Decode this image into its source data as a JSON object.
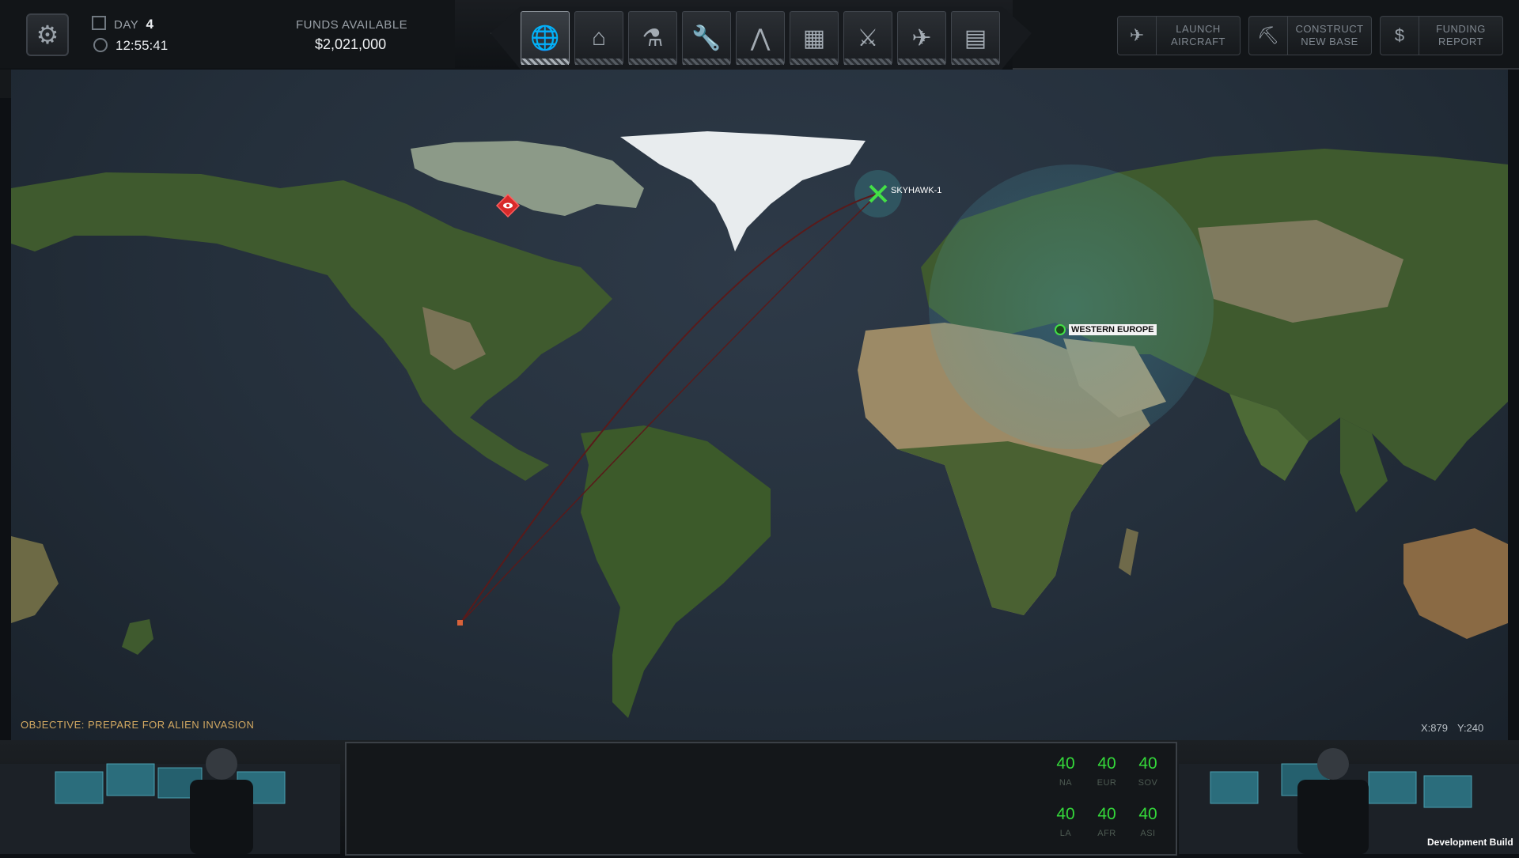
{
  "header": {
    "day_label": "DAY",
    "day_value": "4",
    "time": "12:55:41",
    "funds_label": "FUNDS AVAILABLE",
    "funds_value": "$2,021,000"
  },
  "nav": [
    {
      "name": "geoscape",
      "icon": "globe-icon",
      "active": true
    },
    {
      "name": "base",
      "icon": "hangar-icon",
      "active": false
    },
    {
      "name": "research",
      "icon": "microscope-icon",
      "active": false
    },
    {
      "name": "engineering",
      "icon": "wrench-icon",
      "active": false
    },
    {
      "name": "soldiers",
      "icon": "rank-chevron-icon",
      "active": false
    },
    {
      "name": "stores",
      "icon": "crates-icon",
      "active": false
    },
    {
      "name": "weapons",
      "icon": "rifle-icon",
      "active": false
    },
    {
      "name": "aircraft",
      "icon": "jet-icon",
      "active": false
    },
    {
      "name": "archives",
      "icon": "cabinet-icon",
      "active": false
    }
  ],
  "actions": {
    "launch_aircraft": "LAUNCH\nAIRCRAFT",
    "construct_base": "CONSTRUCT\nNEW BASE",
    "funding_report": "FUNDING\nREPORT"
  },
  "speed": [
    {
      "label": "›",
      "active": true
    },
    {
      "label": "»",
      "active": false
    },
    {
      "label": "⋙",
      "active": false
    },
    {
      "label": "⋙›",
      "active": false
    }
  ],
  "map": {
    "aircraft_label": "SKYHAWK-1",
    "base_label": "WESTERN EUROPE",
    "objective": "OBJECTIVE: PREPARE FOR ALIEN INVASION",
    "coord_x": "X:879",
    "coord_y": "Y:240"
  },
  "panic": [
    {
      "value": "40",
      "region": "NA"
    },
    {
      "value": "40",
      "region": "EUR"
    },
    {
      "value": "40",
      "region": "SOV"
    },
    {
      "value": "40",
      "region": "LA"
    },
    {
      "value": "40",
      "region": "AFR"
    },
    {
      "value": "40",
      "region": "ASI"
    }
  ],
  "footer": {
    "build": "Development Build"
  },
  "colors": {
    "panic_green": "#34d93a",
    "objective_amber": "#d3a962",
    "ocean": "#25303c",
    "land": "#3f5a2e",
    "desert": "#9c8a66",
    "ice": "#e8ecee"
  }
}
